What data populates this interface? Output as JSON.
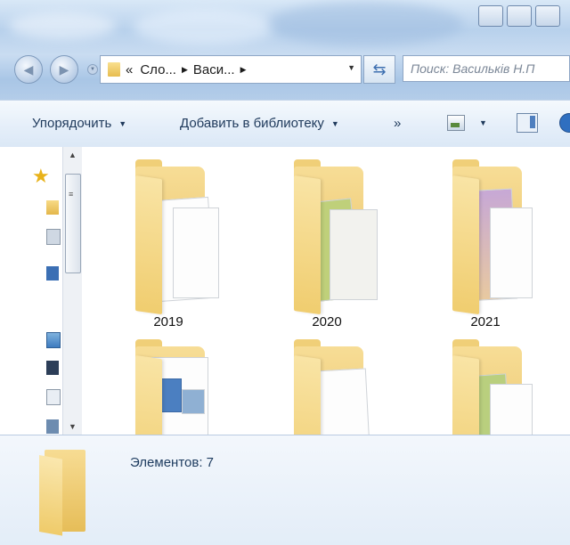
{
  "address_bar": {
    "back_glyph": "«",
    "crumbs": [
      "Сло...",
      "Васи..."
    ],
    "search_placeholder": "Поиск: Васильків Н.П"
  },
  "toolbar": {
    "organize": "Упорядочить",
    "add_to_library": "Добавить в библиотеку",
    "more": "»"
  },
  "folders": [
    {
      "name": "2019"
    },
    {
      "name": "2020"
    },
    {
      "name": "2021"
    },
    {
      "name": ""
    },
    {
      "name": ""
    },
    {
      "name": ""
    }
  ],
  "details": {
    "count_text": "Элементов: 7"
  },
  "colors": {
    "folder": "#e8c063",
    "accent": "#2f6fc0",
    "toolbar_text": "#1e395b"
  }
}
